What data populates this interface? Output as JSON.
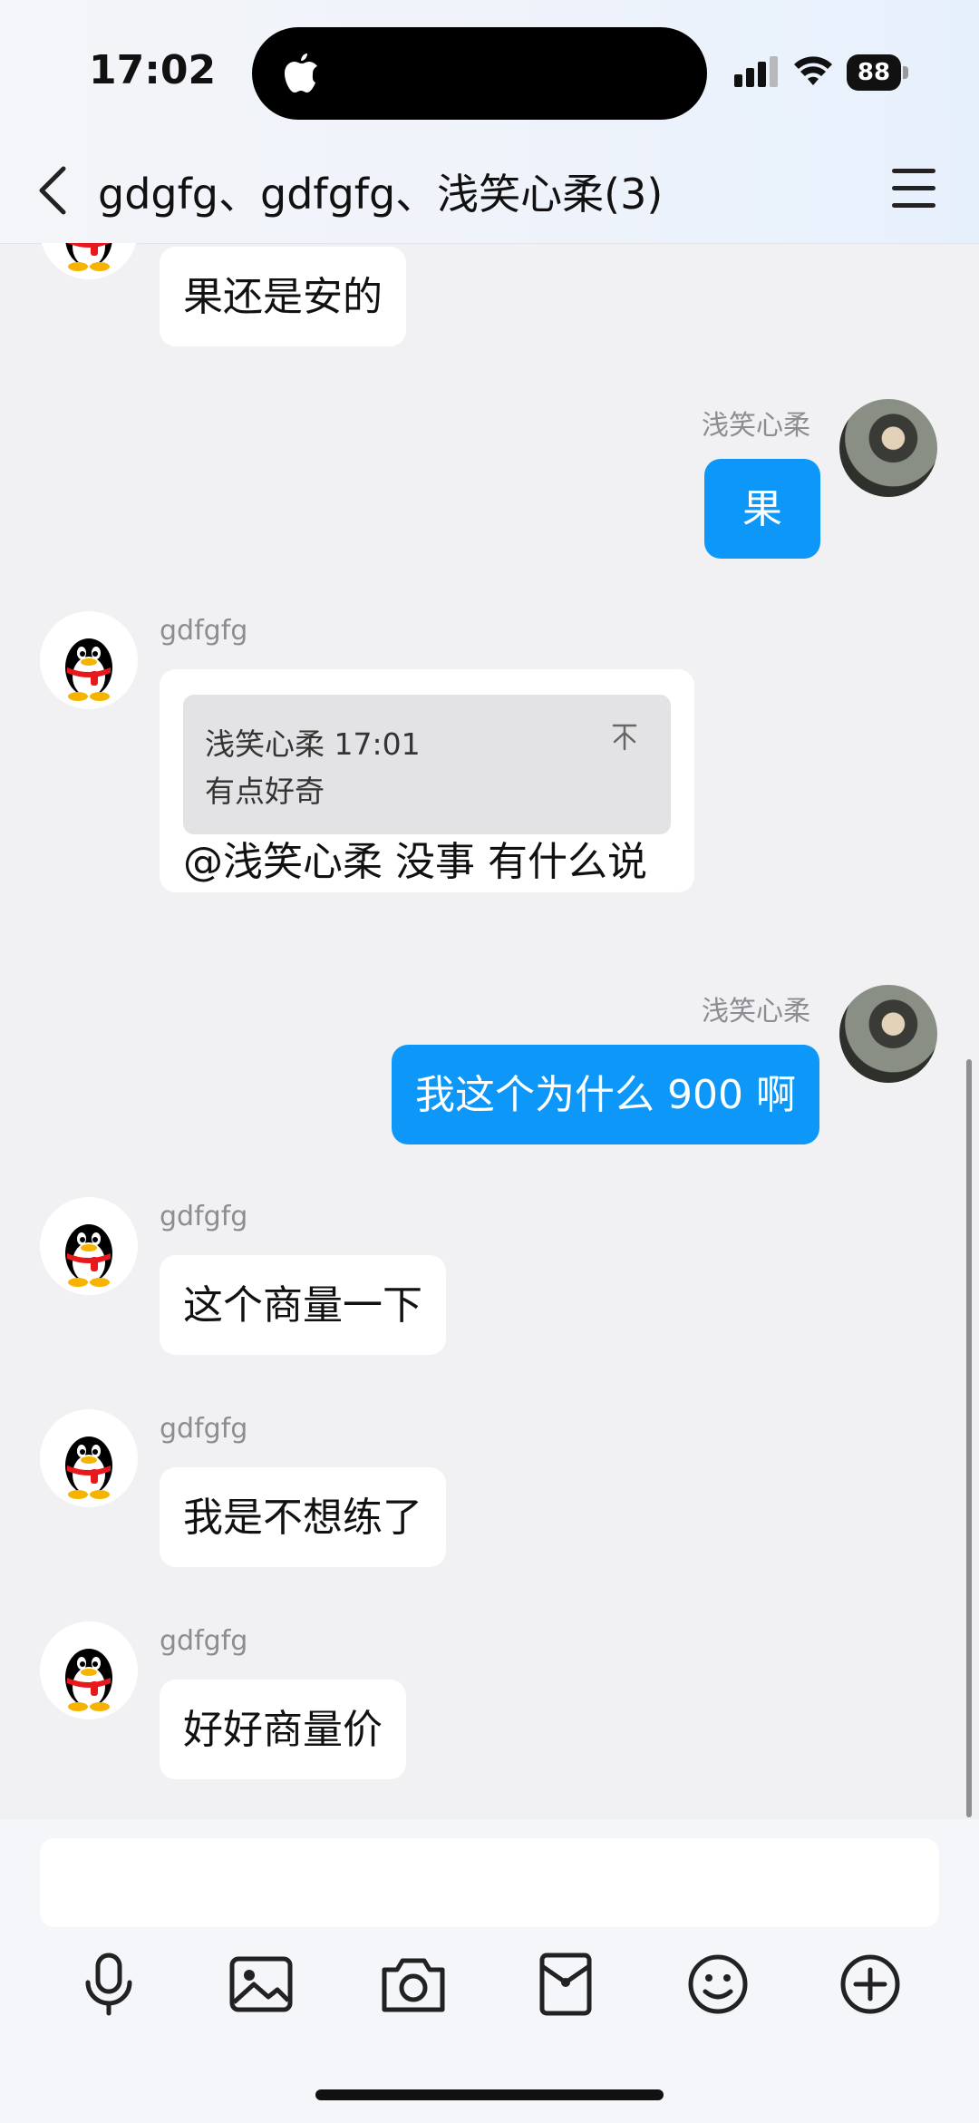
{
  "status": {
    "time": "17:02",
    "battery": "88"
  },
  "nav": {
    "title": "gdgfg、gdfgfg、浅笑心柔(3)"
  },
  "messages": [
    {
      "side": "left",
      "nick": "",
      "text": "果还是安的"
    },
    {
      "side": "right",
      "nick": "浅笑心柔",
      "text": "果"
    },
    {
      "side": "left",
      "nick": "gdfgfg",
      "quote": {
        "author_time": "浅笑心柔 17:01",
        "text": "有点好奇",
        "icon": "pin-icon"
      },
      "text": "@浅笑心柔 没事 有什么说"
    },
    {
      "side": "right",
      "nick": "浅笑心柔",
      "text": "我这个为什么 900 啊"
    },
    {
      "side": "left",
      "nick": "gdfgfg",
      "text": "这个商量一下"
    },
    {
      "side": "left",
      "nick": "gdfgfg",
      "text": "我是不想练了"
    },
    {
      "side": "left",
      "nick": "gdfgfg",
      "text": "好好商量价"
    }
  ],
  "input": {
    "value": "",
    "placeholder": ""
  },
  "toolbar": [
    "microphone-icon",
    "image-icon",
    "camera-icon",
    "red-packet-icon",
    "emoji-icon",
    "plus-icon"
  ],
  "colors": {
    "my_bubble": "#0d98f9",
    "other_bubble": "#ffffff",
    "background": "#f1f1f3"
  }
}
